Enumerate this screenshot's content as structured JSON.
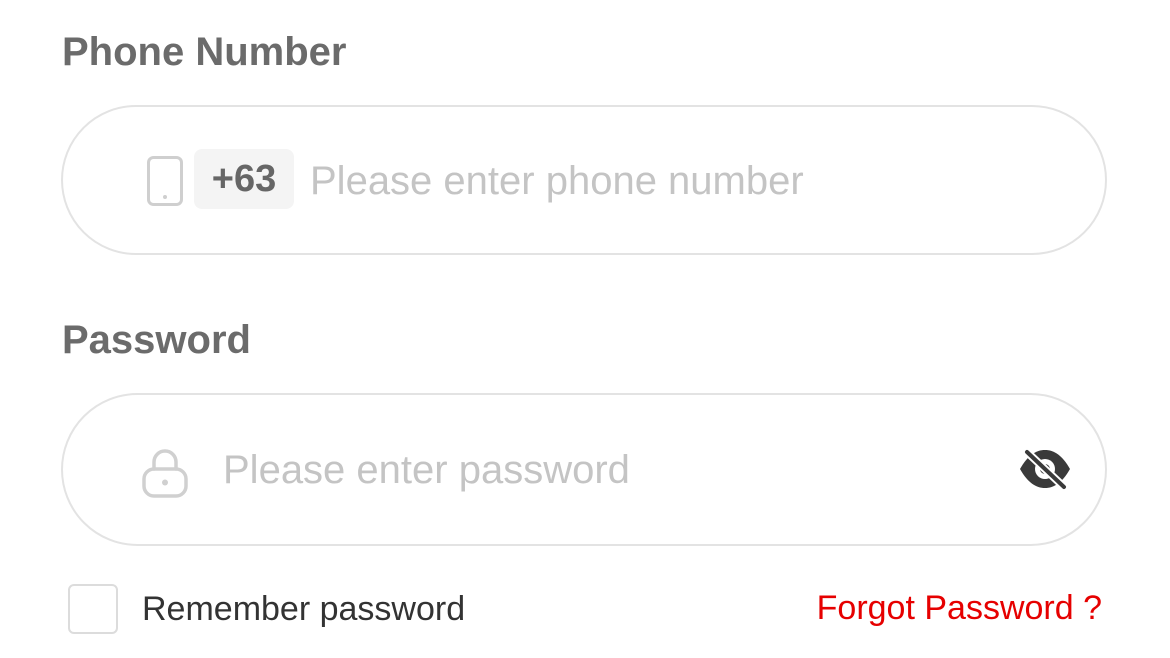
{
  "phone": {
    "label": "Phone Number",
    "country_code": "+63",
    "placeholder": "Please enter phone number",
    "value": "",
    "icon": "mobile-phone-icon"
  },
  "password": {
    "label": "Password",
    "placeholder": "Please enter password",
    "value": "",
    "icon": "lock-icon",
    "visibility_icon": "eye-off-icon"
  },
  "options": {
    "remember_label": "Remember password",
    "remember_checked": false,
    "forgot_label": "Forgot Password ?"
  },
  "colors": {
    "label_text": "#6b6b6b",
    "placeholder": "#c4c4c4",
    "border": "#e3e3e3",
    "link": "#e60000"
  }
}
